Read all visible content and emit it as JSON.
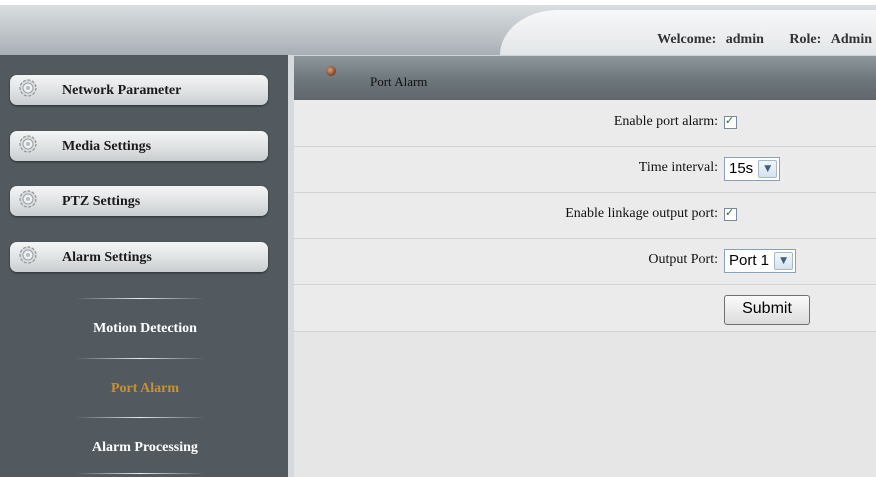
{
  "header": {
    "welcome_label": "Welcome:",
    "user": "admin",
    "role_label": "Role:",
    "role": "Admin"
  },
  "sidebar": {
    "menus": [
      {
        "label": "Network Parameter",
        "icon": "gear-icon"
      },
      {
        "label": "Media Settings",
        "icon": "gear-icon"
      },
      {
        "label": "PTZ Settings",
        "icon": "gear-icon"
      },
      {
        "label": "Alarm Settings",
        "icon": "gear-icon"
      }
    ],
    "sub_items": [
      {
        "label": "Motion Detection",
        "active": false
      },
      {
        "label": "Port Alarm",
        "active": true
      },
      {
        "label": "Alarm Processing",
        "active": false
      }
    ]
  },
  "panel": {
    "title": "Port Alarm",
    "icon": "dot-icon",
    "fields": {
      "enable_port_alarm": {
        "label": "Enable port alarm:",
        "checked": true
      },
      "time_interval": {
        "label": "Time interval:",
        "value": "15s"
      },
      "enable_linkage": {
        "label": "Enable linkage output port:",
        "checked": true
      },
      "output_port": {
        "label": "Output Port:",
        "value": "Port 1"
      }
    },
    "submit_label": "Submit"
  },
  "colors": {
    "sidebar_bg": "#525a5f",
    "active_sub_item": "#c8922c",
    "panel_bg": "#ebebeb"
  }
}
